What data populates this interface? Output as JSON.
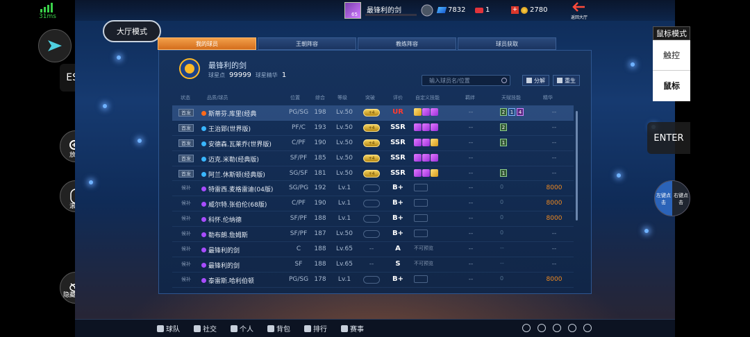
{
  "overlay": {
    "latency": "31ms",
    "esc_label": "ESC",
    "zoom_label": "放大",
    "scroll_label": "滚轮",
    "hide_keys_label": "隐藏按键",
    "mode_title": "鼠标模式",
    "touch_label": "触控",
    "mouse_label": "鼠标",
    "enter_label": "ENTER",
    "left_click_label": "左键点击",
    "right_click_label": "右键点击"
  },
  "top": {
    "player_level": "65",
    "player_name": "最锋利的剑",
    "diamonds": "7832",
    "tickets": "1",
    "coins": "2780",
    "exit_label": "返回大厅"
  },
  "lobby_button": "大厅模式",
  "tabs": [
    {
      "label": "我的球员",
      "active": true
    },
    {
      "label": "王朝阵容",
      "active": false
    },
    {
      "label": "教练阵容",
      "active": false
    },
    {
      "label": "球员获取",
      "active": false
    }
  ],
  "team": {
    "name": "最锋利的剑",
    "points_label": "球星点",
    "points": "99999",
    "essence_label": "球星精华",
    "essence": "1"
  },
  "search": {
    "placeholder": "输入球员名/位置"
  },
  "tools": {
    "decompose": "分解",
    "rebirth": "重生"
  },
  "table": {
    "headers": [
      "状态",
      "品质/球员",
      "位置",
      "综合",
      "等级",
      "突破",
      "评价",
      "自定义技能",
      "羁绊",
      "天赋技能",
      "精华"
    ],
    "rows": [
      {
        "status": "首发",
        "starter": true,
        "dot": "#ff6a1a",
        "name": "斯蒂芬.库里(经典",
        "pos": "PG/SG",
        "ovr": "198",
        "lvl": "Lv.50",
        "brk": "gold",
        "grade": "UR",
        "skills": [
          "y",
          "p",
          "p"
        ],
        "bond": "--",
        "talent": [
          "2",
          "1",
          "4"
        ],
        "cost": "--",
        "selected": true
      },
      {
        "status": "首发",
        "starter": true,
        "dot": "#39b6ff",
        "name": "王治郅(世界版)",
        "pos": "PF/C",
        "ovr": "193",
        "lvl": "Lv.50",
        "brk": "gold",
        "grade": "SSR",
        "skills": [
          "p",
          "p",
          "p"
        ],
        "bond": "--",
        "talent": [
          "2"
        ],
        "cost": "--"
      },
      {
        "status": "首发",
        "starter": true,
        "dot": "#39b6ff",
        "name": "安德森.瓦莱乔(世界版)",
        "pos": "C/PF",
        "ovr": "190",
        "lvl": "Lv.50",
        "brk": "gold",
        "grade": "SSR",
        "skills": [
          "p",
          "p",
          "y"
        ],
        "bond": "--",
        "talent": [
          "1"
        ],
        "cost": "--"
      },
      {
        "status": "首发",
        "starter": true,
        "dot": "#39b6ff",
        "name": "迈克.米勒(经典版)",
        "pos": "SF/PF",
        "ovr": "185",
        "lvl": "Lv.50",
        "brk": "gold",
        "grade": "SSR",
        "skills": [
          "p",
          "p",
          "p"
        ],
        "bond": "--",
        "talent": [],
        "cost": "--"
      },
      {
        "status": "首发",
        "starter": true,
        "dot": "#39b6ff",
        "name": "阿兰.休斯顿(经典版)",
        "pos": "SG/SF",
        "ovr": "181",
        "lvl": "Lv.50",
        "brk": "gold",
        "grade": "SSR",
        "skills": [
          "p",
          "p",
          "y"
        ],
        "bond": "--",
        "talent": [
          "1"
        ],
        "cost": "--"
      },
      {
        "status": "候补",
        "starter": false,
        "dot": "#a84cff",
        "name": "特雷西.麦格雷迪(04版)",
        "pos": "SG/PG",
        "ovr": "192",
        "lvl": "Lv.1",
        "brk": "grey",
        "grade": "B+",
        "skills": "lock",
        "bond": "--",
        "talent": "0",
        "cost": "8000"
      },
      {
        "status": "候补",
        "starter": false,
        "dot": "#a84cff",
        "name": "威尔特.张伯伦(68版)",
        "pos": "C/PF",
        "ovr": "190",
        "lvl": "Lv.1",
        "brk": "grey",
        "grade": "B+",
        "skills": "lock",
        "bond": "--",
        "talent": "0",
        "cost": "8000"
      },
      {
        "status": "候补",
        "starter": false,
        "dot": "#a84cff",
        "name": "科怀.伦纳德",
        "pos": "SF/PF",
        "ovr": "188",
        "lvl": "Lv.1",
        "brk": "grey",
        "grade": "B+",
        "skills": "lock",
        "bond": "--",
        "talent": "0",
        "cost": "8000"
      },
      {
        "status": "候补",
        "starter": false,
        "dot": "#a84cff",
        "name": "勒布朗.詹姆斯",
        "pos": "SF/PF",
        "ovr": "187",
        "lvl": "Lv.50",
        "brk": "grey",
        "grade": "B+",
        "skills": "lock",
        "bond": "--",
        "talent": "0",
        "cost": "--"
      },
      {
        "status": "候补",
        "starter": false,
        "dot": "#a84cff",
        "name": "最锋利的剑",
        "pos": "C",
        "ovr": "188",
        "lvl": "Lv.65",
        "brk": "none",
        "grade": "A",
        "skills": "na",
        "bond": "--",
        "talent": "--",
        "cost": "--"
      },
      {
        "status": "候补",
        "starter": false,
        "dot": "#a84cff",
        "name": "最锋利的剑",
        "pos": "SF",
        "ovr": "188",
        "lvl": "Lv.65",
        "brk": "none",
        "grade": "S",
        "skills": "na",
        "bond": "--",
        "talent": "--",
        "cost": "--"
      },
      {
        "status": "候补",
        "starter": false,
        "dot": "#a84cff",
        "name": "泰雷斯.哈利伯顿",
        "pos": "PG/SG",
        "ovr": "178",
        "lvl": "Lv.1",
        "brk": "grey",
        "grade": "B+",
        "skills": "lock",
        "bond": "--",
        "talent": "0",
        "cost": "8000"
      }
    ],
    "not_preset_text": "不可预览"
  },
  "bottom_nav": [
    "球队",
    "社交",
    "个人",
    "背包",
    "排行",
    "赛事"
  ]
}
